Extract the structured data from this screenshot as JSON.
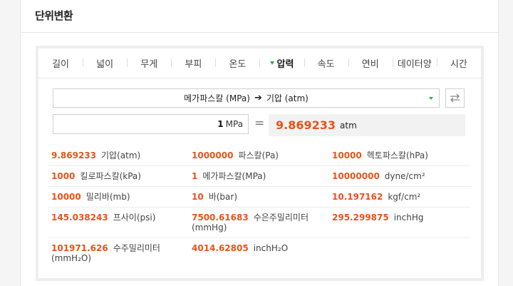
{
  "header": {
    "title": "단위변환"
  },
  "tabs": [
    {
      "label": "길이",
      "active": false
    },
    {
      "label": "넓이",
      "active": false
    },
    {
      "label": "무게",
      "active": false
    },
    {
      "label": "부피",
      "active": false
    },
    {
      "label": "온도",
      "active": false
    },
    {
      "label": "압력",
      "active": true
    },
    {
      "label": "속도",
      "active": false
    },
    {
      "label": "연비",
      "active": false
    },
    {
      "label": "데이터양",
      "active": false
    },
    {
      "label": "시간",
      "active": false
    }
  ],
  "converter": {
    "from_unit": "메가파스칼 (MPa)",
    "arrow": "➔",
    "to_unit": "기압 (atm)",
    "input_value": "1",
    "input_unit": "MPa",
    "equals": "=",
    "result_value": "9.869233",
    "result_unit": "atm"
  },
  "results": [
    [
      {
        "value": "9.869233",
        "unit": "기압(atm)"
      },
      {
        "value": "1000000",
        "unit": "파스칼(Pa)"
      },
      {
        "value": "10000",
        "unit": "헥토파스칼(hPa)"
      }
    ],
    [
      {
        "value": "1000",
        "unit": "킬로파스칼(kPa)"
      },
      {
        "value": "1",
        "unit": "메가파스칼(MPa)"
      },
      {
        "value": "10000000",
        "unit": "dyne/cm²"
      }
    ],
    [
      {
        "value": "10000",
        "unit": "밀리바(mb)"
      },
      {
        "value": "10",
        "unit": "바(bar)"
      },
      {
        "value": "10.197162",
        "unit": "kgf/cm²"
      }
    ],
    [
      {
        "value": "145.038243",
        "unit": "프사이(psi)"
      },
      {
        "value": "7500.61683",
        "unit": "수은주밀리미터 (mmHg)"
      },
      {
        "value": "295.299875",
        "unit": "inchHg"
      }
    ],
    [
      {
        "value": "101971.626",
        "unit": "수주밀리미터 (mmH₂O)"
      },
      {
        "value": "4014.62805",
        "unit": "inchH₂O"
      },
      {
        "value": "",
        "unit": ""
      }
    ]
  ]
}
